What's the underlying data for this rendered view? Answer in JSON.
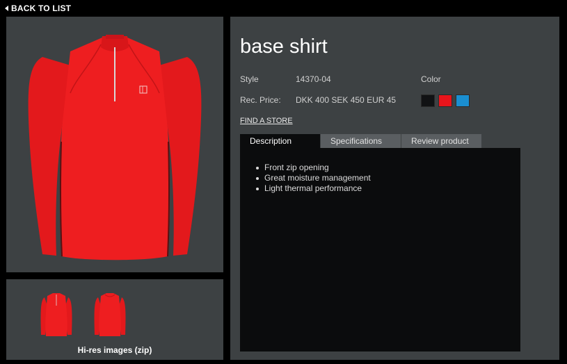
{
  "nav": {
    "back_label": "BACK TO LIST"
  },
  "product": {
    "title": "base shirt",
    "style_label": "Style",
    "style_value": "14370-04",
    "color_label": "Color",
    "price_label": "Rec. Price:",
    "price_value": "DKK 400 SEK 450 EUR 45",
    "colors": [
      "#111214",
      "#e8141b",
      "#1a8ed0"
    ],
    "find_store_label": "FIND A STORE"
  },
  "gallery": {
    "main_image": "red-long-sleeve-shirt",
    "thumbnails": [
      "red-shirt-front",
      "red-shirt-back"
    ],
    "hires_label": "Hi-res images (zip)"
  },
  "tabs": [
    {
      "label": "Description",
      "active": true
    },
    {
      "label": "Specifications",
      "active": false
    },
    {
      "label": "Review product",
      "active": false
    }
  ],
  "description": {
    "bullets": [
      "Front zip opening",
      "Great moisture management",
      "Light thermal performance"
    ]
  }
}
